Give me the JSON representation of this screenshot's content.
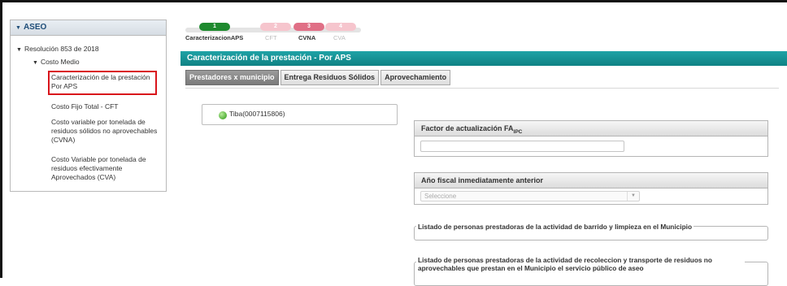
{
  "sidebar": {
    "header": "ASEO",
    "items": [
      {
        "label": "Resolución 853 de 2018"
      },
      {
        "label": "Costo Medio"
      },
      {
        "label": "Caracterización de la prestación Por APS"
      },
      {
        "label": "Costo Fijo Total - CFT"
      },
      {
        "label": "Costo variable por tonelada de residuos sólidos no aprovechables (CVNA)"
      },
      {
        "label": "Costo Variable por tonelada de residuos efectivamente Aprovechados (CVA)"
      }
    ]
  },
  "steps": [
    {
      "number": "1",
      "label": "CaracterizacionAPS"
    },
    {
      "number": "2",
      "label": "CFT"
    },
    {
      "number": "3",
      "label": "CVNA"
    },
    {
      "number": "4",
      "label": "CVA"
    }
  ],
  "title": "Caracterización de la prestación - Por APS",
  "tabs": [
    {
      "label": "Prestadores x municipio",
      "active": true
    },
    {
      "label": "Entrega Residuos Sólidos"
    },
    {
      "label": "Aprovechamiento"
    }
  ],
  "tree": {
    "node_label": "Tiba(0007115806)"
  },
  "form": {
    "factor_label": "Factor de actualización FA",
    "factor_sub": "IPC",
    "factor_value": "",
    "year_label": "Año fiscal inmediatamente anterior",
    "year_placeholder": "Seleccione",
    "barrido_legend": "Listado de personas prestadoras de la actividad de barrido y limpieza en el Municipio",
    "recoleccion_legend": "Listado de personas prestadoras de la actividad de recoleccion y transporte de residuos no aprovechables que prestan en el Municipio el servicio público de aseo"
  },
  "colors": {
    "accent": "#0f8184",
    "step_done": "#1e8a2e",
    "step_current": "#e06f86",
    "selection": "#d9141b"
  }
}
